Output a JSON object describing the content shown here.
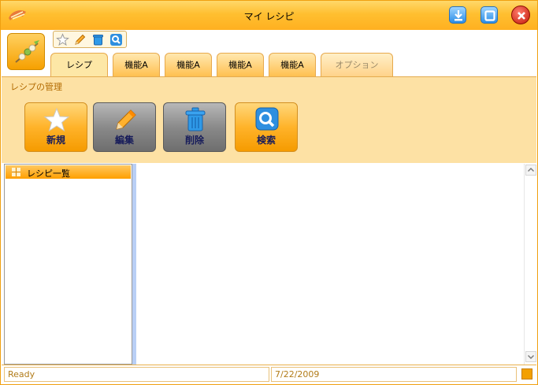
{
  "window": {
    "title": "マイ レシピ",
    "buttons": [
      "minimize-icon",
      "maximize-icon",
      "close-icon"
    ]
  },
  "quick_access": [
    "star-icon",
    "pencil-icon",
    "trash-icon",
    "search-icon"
  ],
  "tabs": [
    {
      "label": "レシプ",
      "active": true
    },
    {
      "label": "機能A"
    },
    {
      "label": "機能A"
    },
    {
      "label": "機能A"
    },
    {
      "label": "機能A"
    },
    {
      "label": "オプション",
      "disabled": true
    }
  ],
  "ribbon": {
    "group_title": "レシプの管理",
    "buttons": [
      {
        "label": "新規",
        "icon": "star-icon"
      },
      {
        "label": "編集",
        "icon": "pencil-icon",
        "pressed": true
      },
      {
        "label": "削除",
        "icon": "trash-icon",
        "pressed": true
      },
      {
        "label": "検索",
        "icon": "search-icon"
      }
    ]
  },
  "sidebar": {
    "items": [
      {
        "label": "レシピ一覧",
        "icon": "grid-icon"
      }
    ]
  },
  "status": {
    "left": "Ready",
    "right": "7/22/2009"
  },
  "colors": {
    "accent": "#ffb020",
    "ribbon_bg": "#fde1a4",
    "button_text": "#161b5a",
    "status_text": "#b17b18"
  }
}
